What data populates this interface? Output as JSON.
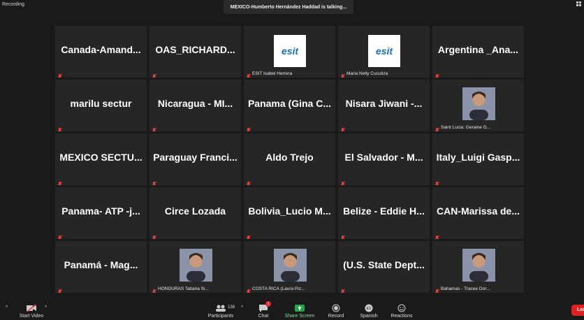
{
  "status": {
    "recording": "Recording",
    "talking": "MEXICO-Humberto Hernández Haddad is talking..."
  },
  "tiles": [
    {
      "name": "Canada-Amand...",
      "label": ""
    },
    {
      "name": "OAS_RICHARD...",
      "label": ""
    },
    {
      "name": "",
      "label": "ESIT Isabel Herrera",
      "logo": "esit"
    },
    {
      "name": "",
      "label": "Maria Nelly Cuculiza",
      "logo": "esit"
    },
    {
      "name": "Argentina _Ana...",
      "label": ""
    },
    {
      "name": "marilu sectur",
      "label": ""
    },
    {
      "name": "Nicaragua - MI...",
      "label": ""
    },
    {
      "name": "Panama (Gina C...",
      "label": ""
    },
    {
      "name": "Nisara Jiwani -...",
      "label": ""
    },
    {
      "name": "",
      "label": "Saint Lucia: Geraine G...",
      "photo": "person"
    },
    {
      "name": "MEXICO SECTU...",
      "label": ""
    },
    {
      "name": "Paraguay Franci...",
      "label": ""
    },
    {
      "name": "Aldo Trejo",
      "label": ""
    },
    {
      "name": "El Salvador - M...",
      "label": ""
    },
    {
      "name": "Italy_Luigi Gasp...",
      "label": ""
    },
    {
      "name": "Panama- ATP -j...",
      "label": ""
    },
    {
      "name": "Circe Lozada",
      "label": ""
    },
    {
      "name": "Bolivia_Lucio M...",
      "label": ""
    },
    {
      "name": "Belize - Eddie H...",
      "label": ""
    },
    {
      "name": "CAN-Marissa de...",
      "label": ""
    },
    {
      "name": "Panamá - Mag...",
      "label": ""
    },
    {
      "name": "",
      "label": "HONDURAS Tatiana Si...",
      "photo": "person"
    },
    {
      "name": "",
      "label": "COSTA RICA (Laura Piz...",
      "photo": "person"
    },
    {
      "name": "(U.S. State Dept...",
      "label": ""
    },
    {
      "name": "",
      "label": "Bahamas - Tracee Dor...",
      "photo": "person"
    }
  ],
  "logo_text": "esit",
  "toolbar": {
    "start_video": "Start Video",
    "participants": "Participants",
    "participants_count": "138",
    "chat": "Chat",
    "chat_badge": "1",
    "share_screen": "Share Screen",
    "record": "Record",
    "spanish": "Spanish",
    "reactions": "Reactions",
    "leave": "Lea"
  },
  "colors": {
    "share_green": "#23a548",
    "leave_red": "#dd2222",
    "mic_muted": "#e0443a"
  }
}
